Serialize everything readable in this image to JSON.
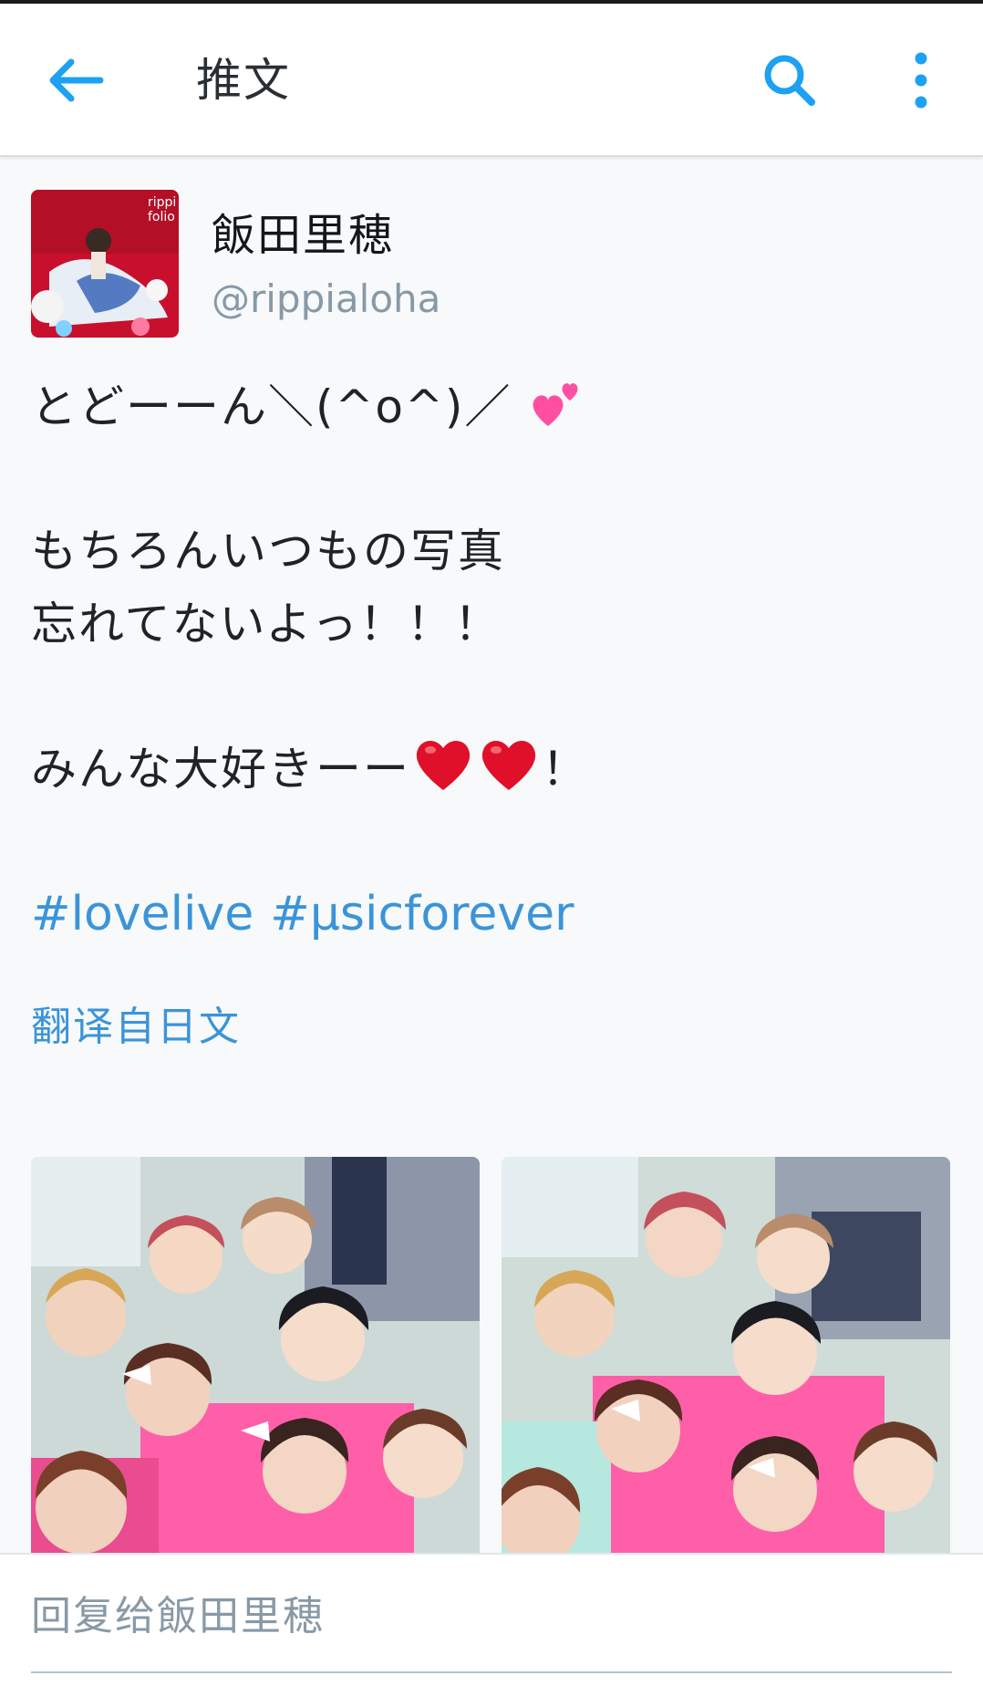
{
  "appbar": {
    "title": "推文",
    "back_icon": "arrow-left-icon",
    "search_icon": "search-icon",
    "more_icon": "more-vertical-icon",
    "accent": "#1da1f2"
  },
  "tweet": {
    "author_name": "飯田里穂",
    "author_handle": "@rippialoha",
    "text_line1": "とどーーん＼(^o^)／",
    "text_line2": "もちろんいつもの写真",
    "text_line3": "忘れてないよっ！！！",
    "text_line4": "みんな大好きーー",
    "text_line4_end": "！",
    "hashtags": [
      "#lovelive",
      "#μsicforever"
    ],
    "translate_label": "翻译自日文",
    "link_color": "#3b94d9"
  },
  "reply": {
    "placeholder": "回复给飯田里穂"
  }
}
